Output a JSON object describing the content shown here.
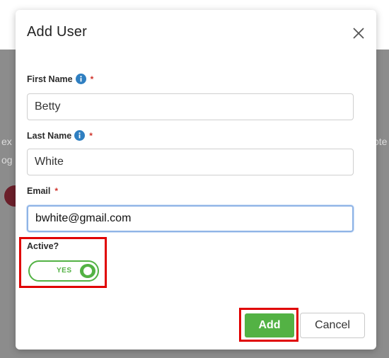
{
  "background": {
    "left_fragments": [
      "ex",
      "og"
    ],
    "right_fragment": "pte"
  },
  "modal": {
    "title": "Add User",
    "close_icon": "close-icon"
  },
  "form": {
    "first_name": {
      "label": "First Name",
      "required": "*",
      "value": "Betty"
    },
    "last_name": {
      "label": "Last Name",
      "required": "*",
      "value": "White"
    },
    "email": {
      "label": "Email",
      "required": "*",
      "value": "bwhite@gmail.com"
    },
    "active": {
      "label": "Active?",
      "toggle_text": "YES",
      "on": true
    }
  },
  "buttons": {
    "add": "Add",
    "cancel": "Cancel"
  },
  "colors": {
    "accent_green": "#53b244",
    "info_blue": "#2f7fc1",
    "required_red": "#d0342c",
    "highlight_red": "#e00000"
  }
}
